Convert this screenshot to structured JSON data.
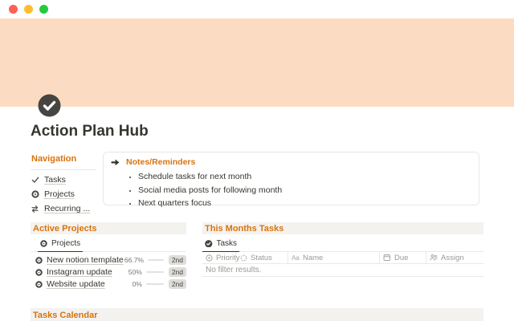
{
  "window": {
    "traffic_lights": [
      {
        "name": "close",
        "color": "#fe5f57"
      },
      {
        "name": "minimize",
        "color": "#ffbd2e"
      },
      {
        "name": "zoom",
        "color": "#27c93f"
      }
    ]
  },
  "page": {
    "title": "Action Plan Hub",
    "icon": "check-circle-icon",
    "cover_color": "#fbdcc3"
  },
  "navigation": {
    "title": "Navigation",
    "items": [
      {
        "icon": "check-icon",
        "label": "Tasks"
      },
      {
        "icon": "target-icon",
        "label": "Projects"
      },
      {
        "icon": "repeat-icon",
        "label": "Recurring ..."
      }
    ]
  },
  "callout": {
    "icon": "arrow-right-icon",
    "title": "Notes/Reminders",
    "bullets": [
      "Schedule tasks for next month",
      "Social media posts for following month",
      "Next quarters focus"
    ]
  },
  "active_projects": {
    "title": "Active Projects",
    "tab_icon": "target-icon",
    "tab_label": "Projects",
    "rows": [
      {
        "icon": "target-icon",
        "name": "New notion template",
        "percent_label": "66.7%",
        "percent": 66.7,
        "badge": "2nd"
      },
      {
        "icon": "target-icon",
        "name": "Instagram update",
        "percent_label": "50%",
        "percent": 50,
        "badge": "2nd"
      },
      {
        "icon": "target-icon",
        "name": "Website update",
        "percent_label": "0%",
        "percent": 0,
        "badge": "2nd"
      }
    ]
  },
  "this_months_tasks": {
    "title": "This Months Tasks",
    "tab_icon": "check-circle-icon",
    "tab_label": "Tasks",
    "columns": [
      {
        "icon": "priority-icon",
        "label": "Priority"
      },
      {
        "icon": "status-icon",
        "label": "Status"
      },
      {
        "icon": "text-icon",
        "label": "Name"
      },
      {
        "icon": "calendar-icon",
        "label": "Due"
      },
      {
        "icon": "assign-icon",
        "label": "Assign"
      }
    ],
    "empty_text": "No filter results."
  },
  "tasks_calendar": {
    "title": "Tasks Calendar"
  },
  "colors": {
    "accent_orange": "#d9730d",
    "cover": "#fbdcc3",
    "text_dark": "#37352f",
    "text_gray": "#9b9a97",
    "border": "#e9e9e7",
    "band_bg": "#f3f2ef",
    "badge_bg": "#dedcd9",
    "progress_fill": "#73726e",
    "progress_track": "#e3e2e0",
    "page_icon_bg": "#454541"
  }
}
